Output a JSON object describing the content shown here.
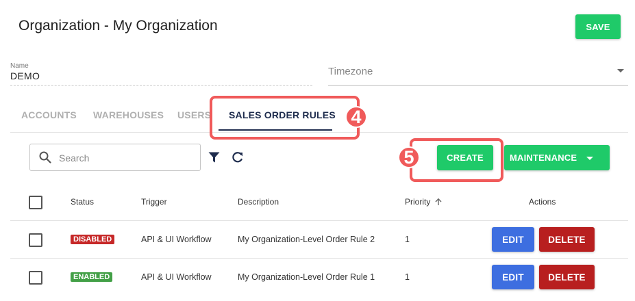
{
  "header": {
    "title": "Organization - My Organization",
    "save_label": "SAVE"
  },
  "form": {
    "name_label": "Name",
    "name_value": "DEMO",
    "timezone_label": "Timezone"
  },
  "tabs": [
    {
      "label": "ACCOUNTS",
      "active": false
    },
    {
      "label": "WAREHOUSES",
      "active": false
    },
    {
      "label": "USERS",
      "active": false
    },
    {
      "label": "SALES ORDER RULES",
      "active": true
    }
  ],
  "callouts": {
    "tab_step": "4",
    "create_step": "5"
  },
  "toolbar": {
    "search_placeholder": "Search",
    "create_label": "CREATE",
    "maintenance_label": "MAINTENANCE"
  },
  "table": {
    "headers": {
      "status": "Status",
      "trigger": "Trigger",
      "description": "Description",
      "priority": "Priority",
      "actions": "Actions"
    },
    "rows": [
      {
        "status": "DISABLED",
        "status_color": "#c62828",
        "trigger": "API & UI Workflow",
        "description": "My Organization-Level Order Rule 2",
        "priority": "1",
        "edit_label": "EDIT",
        "delete_label": "DELETE"
      },
      {
        "status": "ENABLED",
        "status_color": "#43a047",
        "trigger": "API & UI Workflow",
        "description": "My Organization-Level Order Rule 1",
        "priority": "1",
        "edit_label": "EDIT",
        "delete_label": "DELETE"
      }
    ]
  },
  "colors": {
    "accent_green": "#1fca69",
    "edit_blue": "#3d6ee0",
    "delete_red": "#b81f1f",
    "callout_red": "#f05a5a",
    "tab_active": "#1f2d4e"
  }
}
